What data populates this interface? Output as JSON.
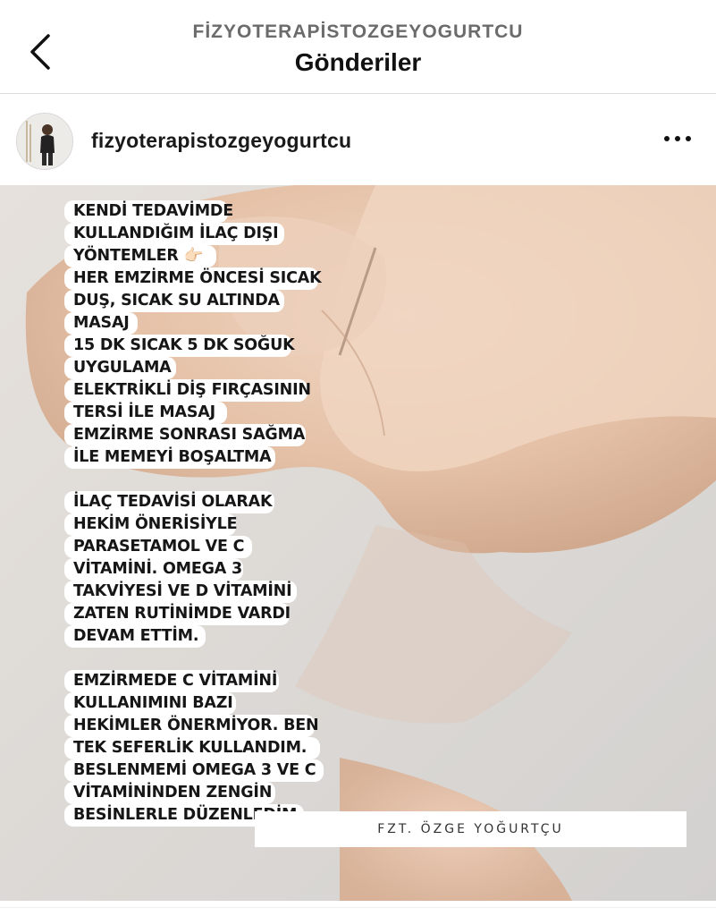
{
  "header": {
    "account": "FİZYOTERAPİSTOZGEYOGURTCU",
    "title": "Gönderiler"
  },
  "post": {
    "username": "fizyoterapistozgeyogurtcu",
    "blocks": [
      "KENDİ TEDAVİMDE\nKULLANDIĞIM İLAÇ DIŞI\nYÖNTEMLER 👉🏻\nHER EMZİRME ÖNCESİ SICAK\nDUŞ, SICAK SU ALTINDA\nMASAJ\n15 DK SICAK 5 DK SOĞUK\nUYGULAMA\nELEKTRİKLİ DİŞ FIRÇASININ\nTERSİ İLE MASAJ\nEMZİRME SONRASI SAĞMA\nİLE MEMEYİ BOŞALTMA",
      "İLAÇ TEDAVİSİ OLARAK\nHEKİM ÖNERİSİYLE\nPARASETAMOL VE C\nVİTAMİNİ. OMEGA 3\nTAKVİYESİ VE D VİTAMİNİ\nZATEN RUTİNİMDE VARDI\nDEVAM ETTİM.",
      "EMZİRMEDE C VİTAMİNİ\nKULLANIMINI BAZI\nHEKİMLER ÖNERMİYOR. BEN\nTEK SEFERLİK KULLANDIM.\nBESLENMEMİ OMEGA 3 VE C\nVİTAMİNİNDEN ZENGİN\nBESİNLERLE DÜZENLEDİM."
    ],
    "caption": "FZT. ÖZGE YOĞURTÇU"
  },
  "icons": {
    "back": "chevron-left-icon",
    "more": "more-horizontal-icon"
  },
  "colors": {
    "background": "#ffffff",
    "photo_skin": "#e8c9b2",
    "photo_bg": "#dcdad6"
  }
}
